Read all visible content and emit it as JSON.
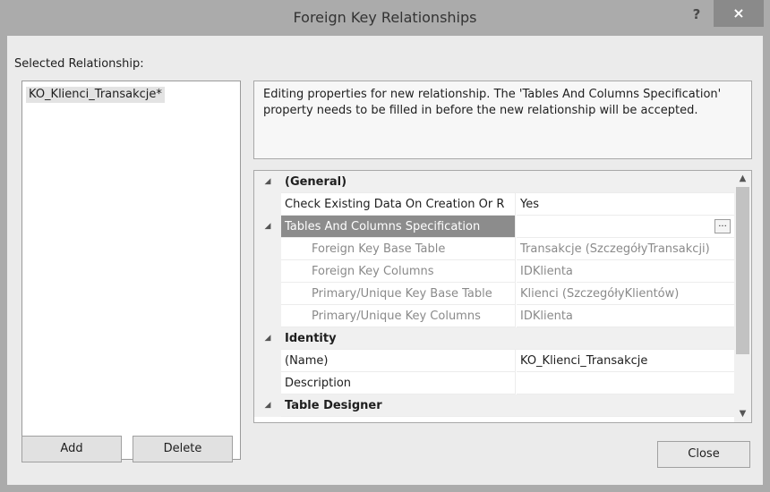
{
  "window": {
    "title": "Foreign Key Relationships",
    "help_label": "?",
    "close_label": "×"
  },
  "selected_relationship_label": "Selected Relationship:",
  "relationships": [
    "KO_Klienci_Transakcje*"
  ],
  "description": "Editing properties for new relationship.  The 'Tables And Columns Specification' property needs to be filled in before the new relationship will be accepted.",
  "properties": [
    {
      "kind": "category",
      "expander": "◢",
      "name": "(General)",
      "value": ""
    },
    {
      "kind": "property",
      "expander": "",
      "name": "Check Existing Data On Creation Or R",
      "value": "Yes"
    },
    {
      "kind": "property-selected",
      "expander": "◢",
      "name": "Tables And Columns Specification",
      "value": "",
      "button": "..."
    },
    {
      "kind": "sub",
      "expander": "",
      "name": "Foreign Key Base Table",
      "value": "Transakcje (SzczegółyTransakcji)"
    },
    {
      "kind": "sub",
      "expander": "",
      "name": "Foreign Key Columns",
      "value": "IDKlienta"
    },
    {
      "kind": "sub",
      "expander": "",
      "name": "Primary/Unique Key Base Table",
      "value": "Klienci (SzczegółyKlientów)"
    },
    {
      "kind": "sub",
      "expander": "",
      "name": "Primary/Unique Key Columns",
      "value": "IDKlienta"
    },
    {
      "kind": "category",
      "expander": "◢",
      "name": "Identity",
      "value": ""
    },
    {
      "kind": "property",
      "expander": "",
      "name": "(Name)",
      "value": "KO_Klienci_Transakcje"
    },
    {
      "kind": "property",
      "expander": "",
      "name": "Description",
      "value": ""
    },
    {
      "kind": "category",
      "expander": "◢",
      "name": "Table Designer",
      "value": ""
    }
  ],
  "scrollbar": {
    "up": "▲",
    "down": "▼"
  },
  "buttons": {
    "add": "Add",
    "delete": "Delete",
    "close": "Close"
  }
}
